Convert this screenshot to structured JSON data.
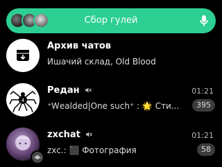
{
  "search": {
    "title": "Сбор гулей"
  },
  "chats": [
    {
      "name": "Архив чатов",
      "preview": "Ишачий склад, Old Blood"
    },
    {
      "name": "Редан",
      "preview": "⁺Ꮃealded|One such⁺ : 🌟 Сти...",
      "time": "01:21",
      "badge": "395"
    },
    {
      "name": "zxchat",
      "preview": "zxc.: ⬛ Фотография",
      "time": "01:21",
      "badge": "58"
    }
  ]
}
